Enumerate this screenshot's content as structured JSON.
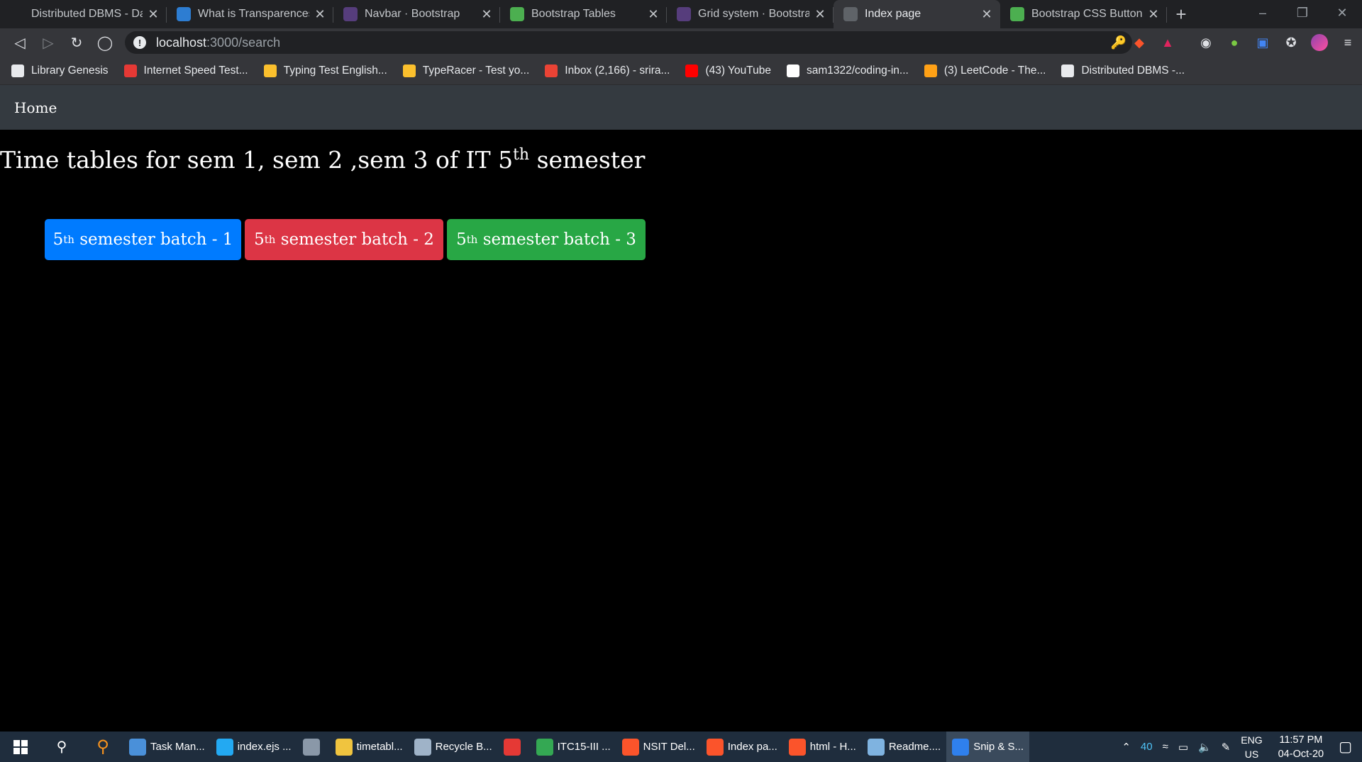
{
  "browser": {
    "tabs": [
      {
        "title": "Distributed DBMS - Data",
        "favicon": "gear-logo-icon",
        "color": "#202124"
      },
      {
        "title": "What is Transparences in",
        "favicon": "site-logo-icon",
        "color": "#2d7dd2"
      },
      {
        "title": "Navbar · Bootstrap",
        "favicon": "bootstrap-icon",
        "color": "#563d7c"
      },
      {
        "title": "Bootstrap Tables",
        "favicon": "w3schools-icon",
        "color": "#4caf50"
      },
      {
        "title": "Grid system · Bootstrap",
        "favicon": "bootstrap-icon",
        "color": "#563d7c"
      },
      {
        "title": "Index page",
        "favicon": "globe-icon",
        "color": "#5f6368",
        "active": true
      },
      {
        "title": "Bootstrap CSS Buttons R",
        "favicon": "w3schools-icon",
        "color": "#4caf50"
      }
    ],
    "url_host": "localhost",
    "url_path": ":3000/search",
    "bookmarks": [
      {
        "label": "Library Genesis",
        "icon": "book-icon",
        "color": "#e8eaed"
      },
      {
        "label": "Internet Speed Test...",
        "icon": "speedometer-icon",
        "color": "#e53935"
      },
      {
        "label": "Typing Test English...",
        "icon": "keyboard-icon",
        "color": "#fbc02d"
      },
      {
        "label": "TypeRacer - Test yo...",
        "icon": "race-icon",
        "color": "#fbc02d"
      },
      {
        "label": "Inbox (2,166) - srira...",
        "icon": "gmail-icon",
        "color": "#ea4335"
      },
      {
        "label": "(43) YouTube",
        "icon": "youtube-icon",
        "color": "#ff0000"
      },
      {
        "label": "sam1322/coding-in...",
        "icon": "github-icon",
        "color": "#ffffff"
      },
      {
        "label": "(3) LeetCode - The...",
        "icon": "leetcode-icon",
        "color": "#ffa116"
      },
      {
        "label": "Distributed DBMS -...",
        "icon": "gear-logo-icon",
        "color": "#e8eaed"
      }
    ]
  },
  "page": {
    "nav_home": "Home",
    "heading_pre": "Time tables for sem 1, sem 2 ,sem 3 of IT 5",
    "heading_sup": "th",
    "heading_post": " semester",
    "buttons": [
      {
        "num": "5",
        "sup": "th",
        "label": " semester batch - 1",
        "color": "#007bff"
      },
      {
        "num": "5",
        "sup": "th",
        "label": " semester batch - 2",
        "color": "#dc3545"
      },
      {
        "num": "5",
        "sup": "th",
        "label": " semester batch - 3",
        "color": "#28a745"
      }
    ]
  },
  "taskbar": {
    "items": [
      {
        "label": "Task Man...",
        "icon": "task-manager-icon",
        "color": "#4a90d9"
      },
      {
        "label": "index.ejs ...",
        "icon": "vscode-icon",
        "color": "#23a9f2"
      },
      {
        "label": "",
        "icon": "settings-app-icon",
        "color": "#8a98a8"
      },
      {
        "label": "timetabl...",
        "icon": "folder-icon",
        "color": "#f0c43f"
      },
      {
        "label": "Recycle B...",
        "icon": "recycle-bin-icon",
        "color": "#9fb3c8"
      },
      {
        "label": "",
        "icon": "t-app-icon",
        "color": "#e53935"
      },
      {
        "label": "ITC15-III ...",
        "icon": "chrome-icon",
        "color": "#34a853"
      },
      {
        "label": "NSIT Del...",
        "icon": "brave-icon",
        "color": "#fb542b"
      },
      {
        "label": "Index pa...",
        "icon": "brave-icon",
        "color": "#fb542b"
      },
      {
        "label": "html - H...",
        "icon": "brave-icon",
        "color": "#fb542b"
      },
      {
        "label": "Readme....",
        "icon": "notepad-icon",
        "color": "#7fb3e0"
      },
      {
        "label": "Snip & S...",
        "icon": "snip-icon",
        "color": "#2f80ed",
        "active": true
      }
    ],
    "tray_temp": "40",
    "lang_top": "ENG",
    "lang_bottom": "US",
    "time": "11:57 PM",
    "date": "04-Oct-20"
  }
}
